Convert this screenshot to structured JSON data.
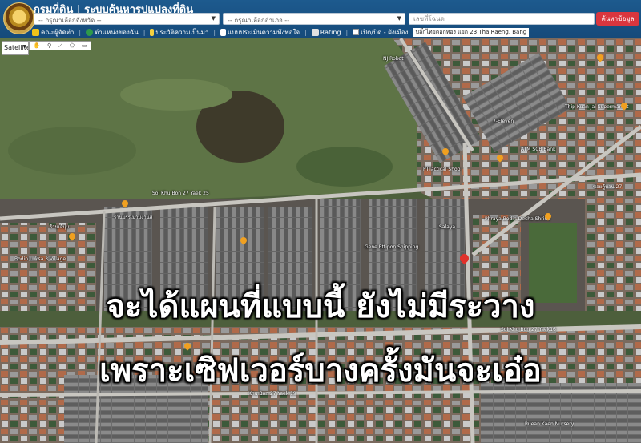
{
  "header": {
    "title": "กรมที่ดิน | ระบบค้นหารูปแปลงที่ดิน",
    "province_select": "-- กรุณาเลือกจังหวัด --",
    "district_select": "-- กรุณาเลือกอำเภอ --",
    "search_placeholder": "เลขที่โฉนด",
    "search_button": "ค้นหาข้อมูล"
  },
  "toolbar": {
    "items": [
      {
        "label": "คณะผู้จัดทำ",
        "icon": "book-icon",
        "color": "#f0c419"
      },
      {
        "label": "ตำแหน่งของฉัน",
        "icon": "location-icon",
        "color": "#2e9a4a"
      },
      {
        "label": "ประวัติความเป็นมา",
        "icon": "sprout-icon",
        "color": "#f4d03f"
      },
      {
        "label": "แบบประเมินความพึงพอใจ",
        "icon": "document-icon",
        "color": "#ffffff"
      },
      {
        "label": "Rating",
        "icon": "chart-icon",
        "color": "#e0e0e0"
      },
      {
        "label": "เปิด/ปิด - ผังเมือง",
        "icon": "checkbox-icon",
        "color": "#ffffff"
      }
    ],
    "address": "ปลั๊กไทยดอกทอง แยก 23 Tha Raeng, Bang"
  },
  "map_controls": {
    "map_type": "Satellite",
    "draw_tools": [
      "✋",
      "⚲",
      "⟋",
      "⬠",
      "▭"
    ]
  },
  "map_labels": [
    "Soi Khu Bon 27 Yaek 25",
    "Bodin Luksa 3 Village",
    "Khu Bon 27 Yaek 19",
    "ATM SCB Bank",
    "NJ Robot",
    "PTTactical Shop",
    "Gene Ettipon Shipping",
    "Salaya",
    "Phraya Bodin Decha Shrine",
    "Ruean Kaen Nursery",
    "7-Eleven",
    "Thip Kuan Jai Supermarket",
    "ร้านเจ้นุ่ม",
    "ร้านบรรเมามงานส",
    "ซอยคู้บอน 27",
    "Soi Khu Bon 27 Yaek16"
  ],
  "caption": {
    "line1": "จะได้แผนที่แบบนี้ ยังไม่มีระวาง",
    "line2": "เพราะเซิฟเวอร์บางครั้งมันจะเอ๋อ"
  },
  "colors": {
    "header_bg": "#1d5a8e",
    "search_button": "#d9363e",
    "marker_orange": "#f0a020",
    "marker_red": "#e0312b"
  }
}
